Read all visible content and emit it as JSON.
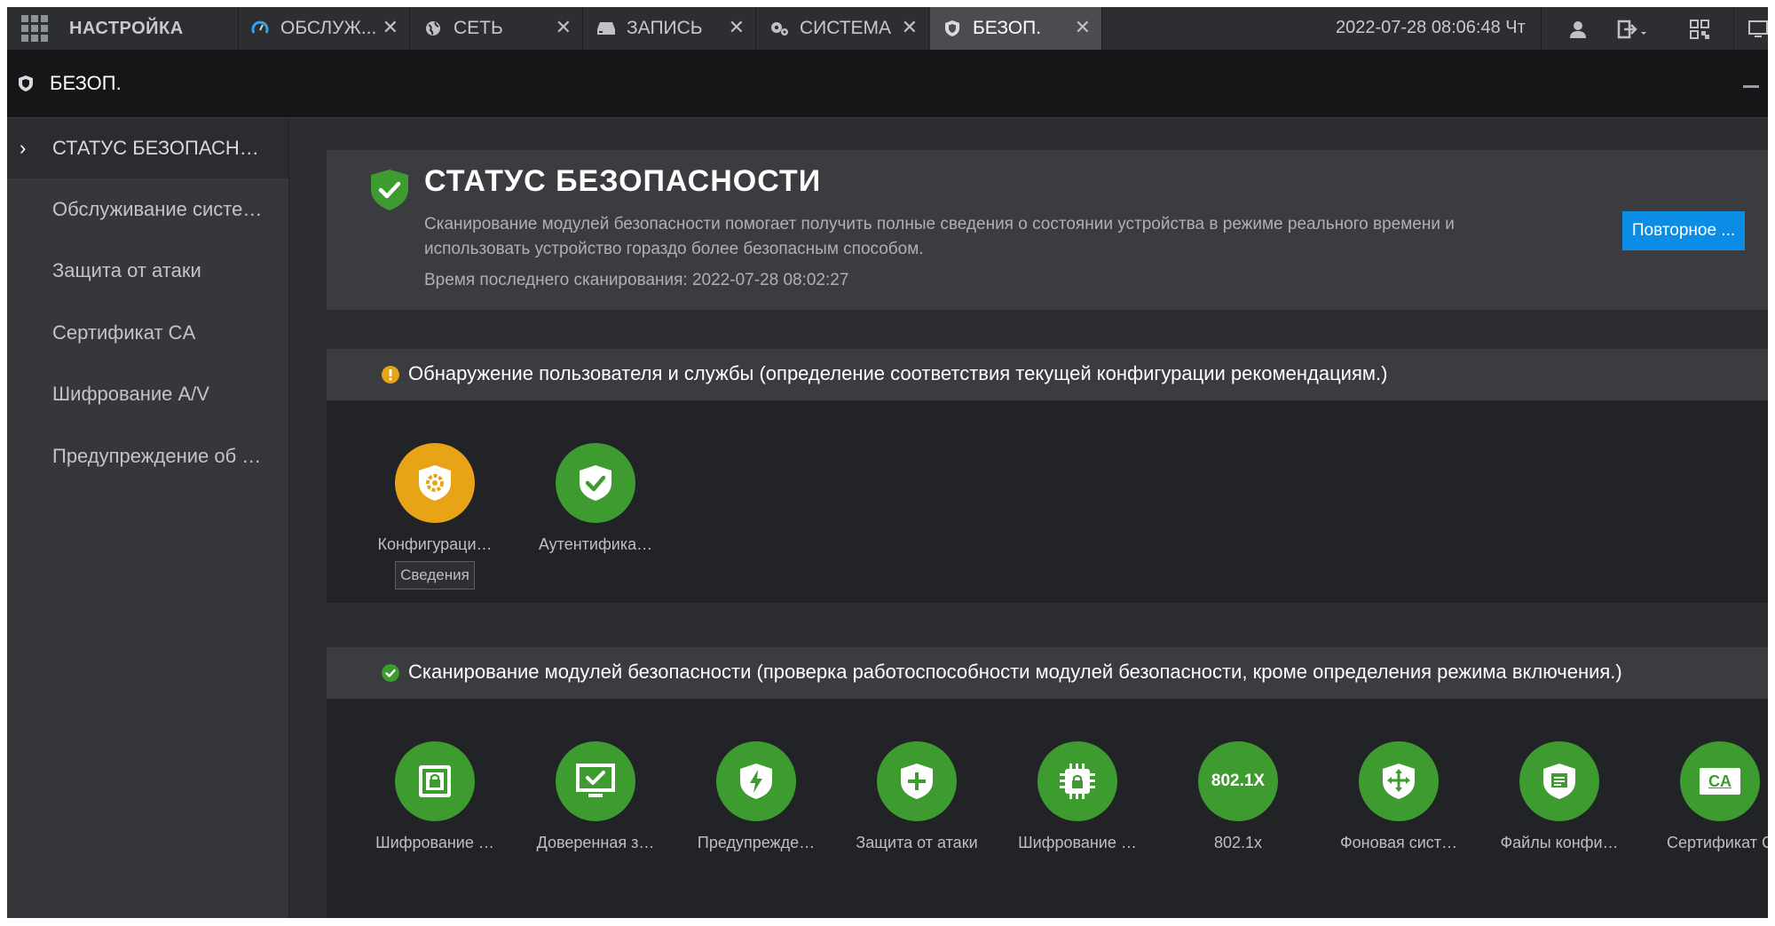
{
  "topbar": {
    "brand_label": "НАСТРОЙКА",
    "tabs": [
      {
        "label": "ОБСЛУЖ...",
        "icon": "gauge-icon",
        "active": false
      },
      {
        "label": "СЕТЬ",
        "icon": "globe-icon",
        "active": false
      },
      {
        "label": "ЗАПИСЬ",
        "icon": "storage-icon",
        "active": false
      },
      {
        "label": "СИСТЕМА",
        "icon": "gears-icon",
        "active": false
      },
      {
        "label": "БЕЗОП.",
        "icon": "shield-icon",
        "active": true
      }
    ],
    "close_glyph": "✕",
    "datetime": "2022-07-28 08:06:48 Чт"
  },
  "section": {
    "title": "БЕЗОП."
  },
  "sidebar": {
    "items": [
      {
        "label": "СТАТУС БЕЗОПАСН…",
        "active": true
      },
      {
        "label": "Обслуживание систе…",
        "active": false
      },
      {
        "label": "Защита от атаки",
        "active": false
      },
      {
        "label": "Сертификат CA",
        "active": false
      },
      {
        "label": "Шифрование A/V",
        "active": false
      },
      {
        "label": "Предупреждение об …",
        "active": false
      }
    ]
  },
  "status": {
    "title": "СТАТУС БЕЗОПАСНОСТИ",
    "description": "Сканирование модулей безопасности помогает получить полные сведения о состоянии устройства в режиме реального времени и использовать устройство гораздо более безопасным способом.",
    "last_scan_label": "Время последнего сканирования:",
    "last_scan_time": "2022-07-28 08:02:27",
    "rescan_button": "Повторное ..."
  },
  "detection": {
    "header": "Обнаружение пользователя и службы (определение соответствия текущей конфигурации рекомендациям.)",
    "items": [
      {
        "label": "Конфигураци…",
        "state": "warning",
        "icon": "gear-shield-icon"
      },
      {
        "label": "Аутентифика…",
        "state": "ok",
        "icon": "check-shield-icon"
      }
    ],
    "details_button": "Сведения"
  },
  "scan": {
    "header": "Сканирование модулей безопасности (проверка работоспособности модулей безопасности, кроме определения режима включения.)",
    "items": [
      {
        "label": "Шифрование …",
        "icon": "lock-box-icon"
      },
      {
        "label": "Доверенная з…",
        "icon": "monitor-check-icon"
      },
      {
        "label": "Предупрежде…",
        "icon": "bolt-shield-icon"
      },
      {
        "label": "Защита от атаки",
        "icon": "plus-shield-icon"
      },
      {
        "label": "Шифрование …",
        "icon": "chip-lock-icon"
      },
      {
        "label": "802.1x",
        "icon": "802-1x-icon",
        "badge": "802.1X"
      },
      {
        "label": "Фоновая сист…",
        "icon": "move-shield-icon"
      },
      {
        "label": "Файлы конфи…",
        "icon": "file-shield-icon"
      },
      {
        "label": "Сертификат С",
        "icon": "ca-certificate-icon",
        "badge": "CA"
      }
    ]
  },
  "colors": {
    "accent_blue": "#0b8de6",
    "ok_green": "#3e9b2f",
    "warn_orange": "#e8a317"
  }
}
